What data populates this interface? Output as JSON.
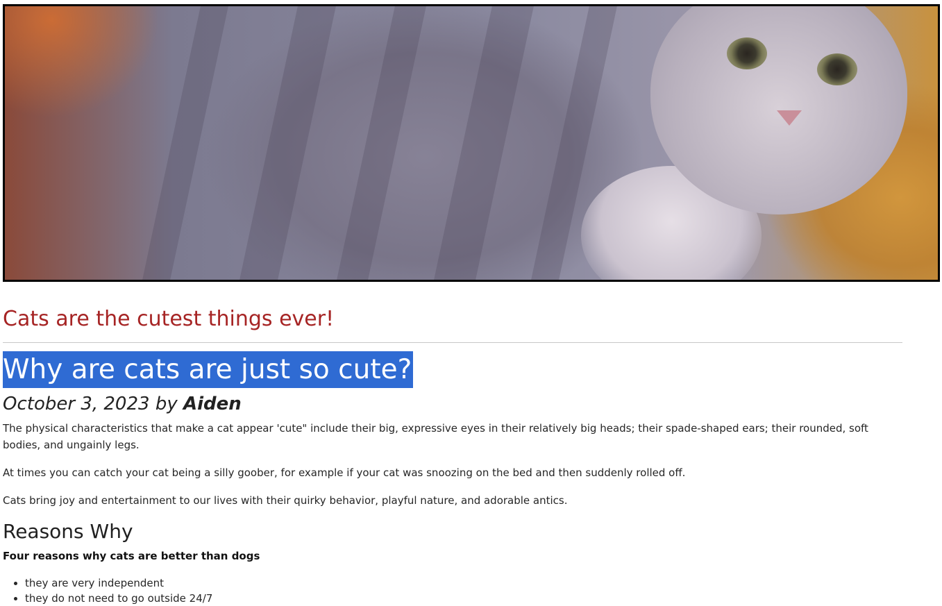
{
  "hero": {
    "image_name": "gray-tabby-cat-photo"
  },
  "subtitle": "Cats are the cutest things ever!",
  "article": {
    "title": "Why are cats are just so cute?",
    "byline_date": "October 3, 2023",
    "byline_by": "by",
    "byline_author": "Aiden",
    "paragraphs": [
      "The physical characteristics that make a cat appear 'cute\" include their big, expressive eyes in their relatively big heads; their spade-shaped ears; their rounded, soft bodies, and ungainly legs.",
      "At times you can catch your cat being a silly goober, for example if your cat was snoozing on the bed and then suddenly rolled off.",
      "Cats bring joy and entertainment to our lives with their quirky behavior, playful nature, and adorable antics."
    ]
  },
  "reasons": {
    "heading": "Reasons Why",
    "lead": "Four reasons why cats are better than dogs",
    "items": [
      "they are very independent",
      "they do not need to go outside 24/7"
    ]
  },
  "colors": {
    "subtitle": "#a62424",
    "selection": "#2f6bd3"
  }
}
